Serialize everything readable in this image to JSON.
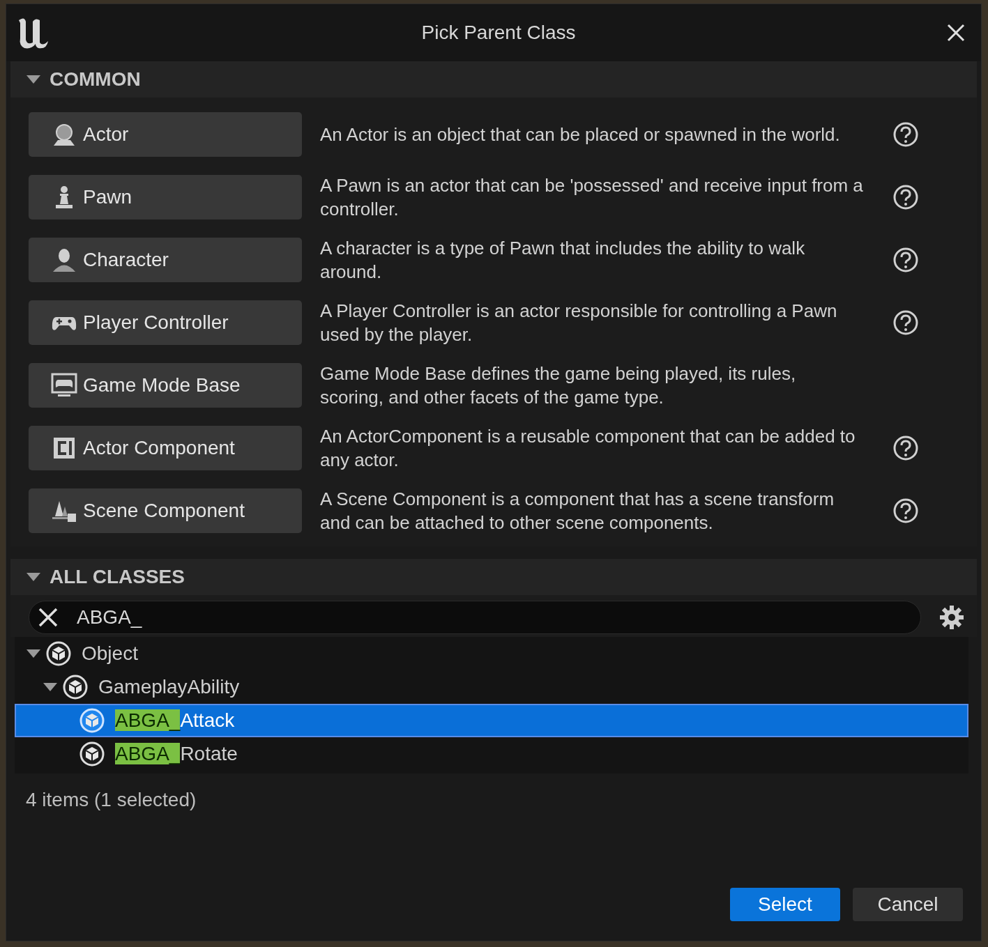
{
  "window": {
    "title": "Pick Parent Class"
  },
  "common": {
    "title": "COMMON",
    "expanded": true,
    "items": [
      {
        "kind": "actor",
        "label": "Actor",
        "description": "An Actor is an object that can be placed or spawned in the world.",
        "help": true
      },
      {
        "kind": "pawn",
        "label": "Pawn",
        "description": "A Pawn is an actor that can be 'possessed' and receive input from a controller.",
        "help": true
      },
      {
        "kind": "character",
        "label": "Character",
        "description": "A character is a type of Pawn that includes the ability to walk around.",
        "help": true
      },
      {
        "kind": "controller",
        "label": "Player Controller",
        "description": "A Player Controller is an actor responsible for controlling a Pawn used by the player.",
        "help": true
      },
      {
        "kind": "gamemode",
        "label": "Game Mode Base",
        "description": "Game Mode Base defines the game being played, its rules, scoring, and other facets of the game type.",
        "help": false
      },
      {
        "kind": "component",
        "label": "Actor Component",
        "description": "An ActorComponent is a reusable component that can be added to any actor.",
        "help": true
      },
      {
        "kind": "scene",
        "label": "Scene Component",
        "description": "A Scene Component is a component that has a scene transform and can be attached to other scene components.",
        "help": true
      }
    ]
  },
  "all_classes": {
    "title": "ALL CLASSES",
    "expanded": true,
    "search": {
      "value": "ABGA_"
    },
    "tree": [
      {
        "label": "Object",
        "expanded": true,
        "selected": false,
        "children": [
          {
            "label": "GameplayAbility",
            "expanded": true,
            "selected": false,
            "children": [
              {
                "match": "ABGA_",
                "rest": "Attack",
                "selected": true
              },
              {
                "match": "ABGA_",
                "rest": "Rotate",
                "selected": false
              }
            ]
          }
        ]
      }
    ],
    "status": "4 items (1 selected)"
  },
  "buttons": [
    {
      "kind": "primary",
      "label": "Select"
    },
    {
      "kind": "secondary",
      "label": "Cancel"
    }
  ]
}
